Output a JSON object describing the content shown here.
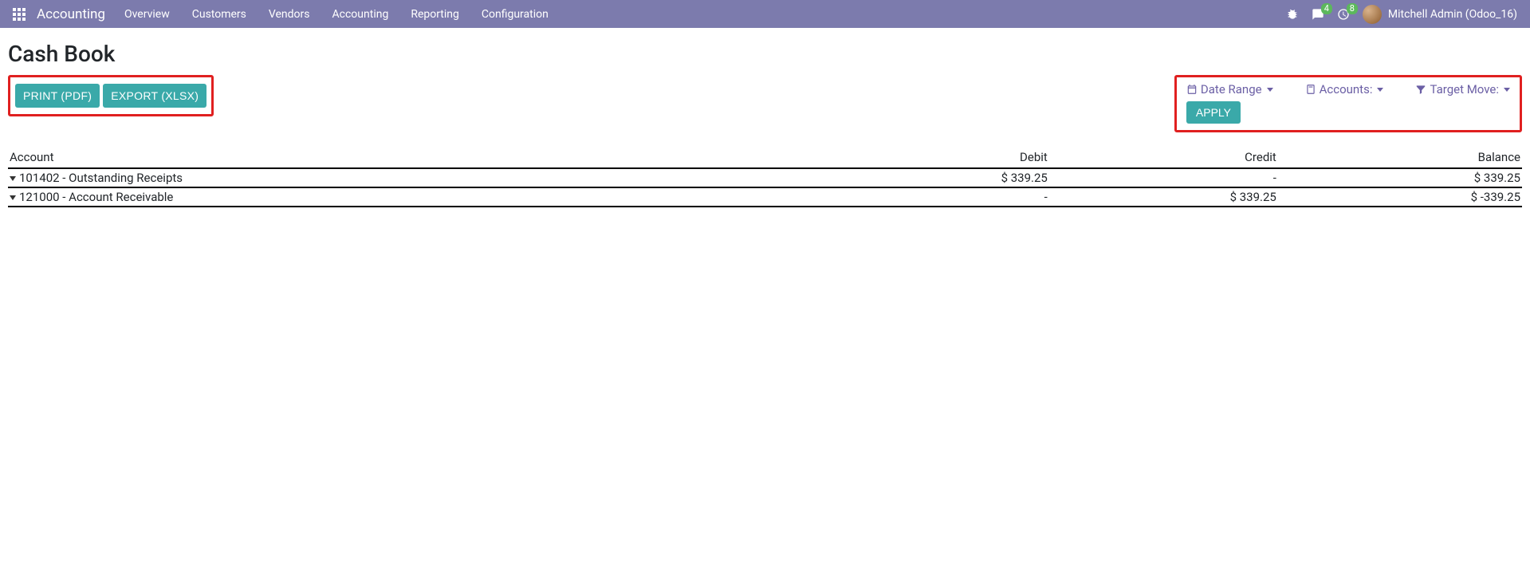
{
  "navbar": {
    "app_title": "Accounting",
    "menu": [
      "Overview",
      "Customers",
      "Vendors",
      "Accounting",
      "Reporting",
      "Configuration"
    ],
    "messages_badge": "4",
    "activities_badge": "8",
    "user_name": "Mitchell Admin (Odoo_16)"
  },
  "page": {
    "title": "Cash Book",
    "print_label": "PRINT (PDF)",
    "export_label": "EXPORT (XLSX)",
    "apply_label": "APPLY"
  },
  "filters": {
    "date_range_label": "Date Range",
    "accounts_label": "Accounts:",
    "target_move_label": "Target Move:"
  },
  "table": {
    "headers": {
      "account": "Account",
      "debit": "Debit",
      "credit": "Credit",
      "balance": "Balance"
    },
    "rows": [
      {
        "account": "101402 - Outstanding Receipts",
        "debit": "$ 339.25",
        "credit": "-",
        "balance": "$ 339.25"
      },
      {
        "account": "121000 - Account Receivable",
        "debit": "-",
        "credit": "$ 339.25",
        "balance": "$ -339.25"
      }
    ]
  }
}
